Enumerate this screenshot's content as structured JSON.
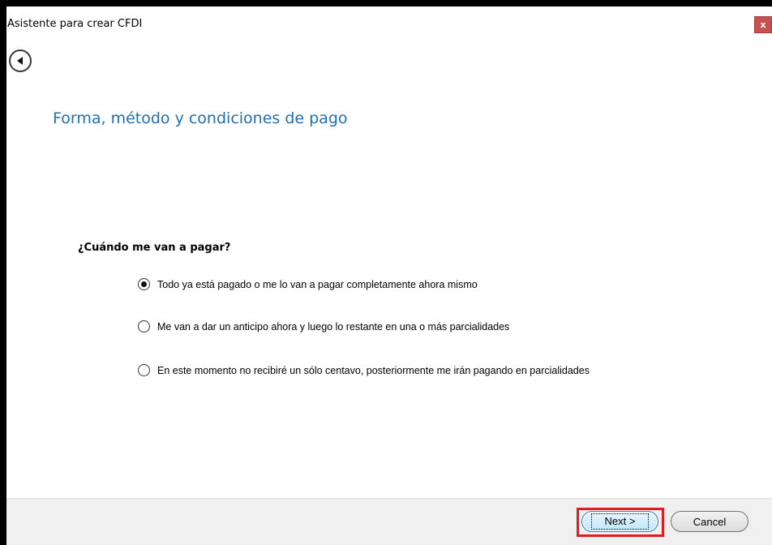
{
  "window": {
    "title": "Asistente para crear CFDI",
    "close_label": "x"
  },
  "page": {
    "heading": "Forma, método y condiciones de pago",
    "question": "¿Cuándo me van a pagar?",
    "options": [
      {
        "label": "Todo ya está pagado o me lo van a pagar completamente ahora mismo",
        "selected": true
      },
      {
        "label": "Me van a dar un anticipo ahora y luego lo restante en una o más parcialidades",
        "selected": false
      },
      {
        "label": "En este momento no recibiré un sólo centavo, posteriormente me irán pagando en parcialidades",
        "selected": false
      }
    ]
  },
  "footer": {
    "next_label": "Next >",
    "cancel_label": "Cancel"
  },
  "colors": {
    "heading": "#1e6fb5",
    "close_button": "#c75050",
    "highlight": "#e8191e"
  },
  "icons": {
    "back": "back-arrow-icon"
  }
}
